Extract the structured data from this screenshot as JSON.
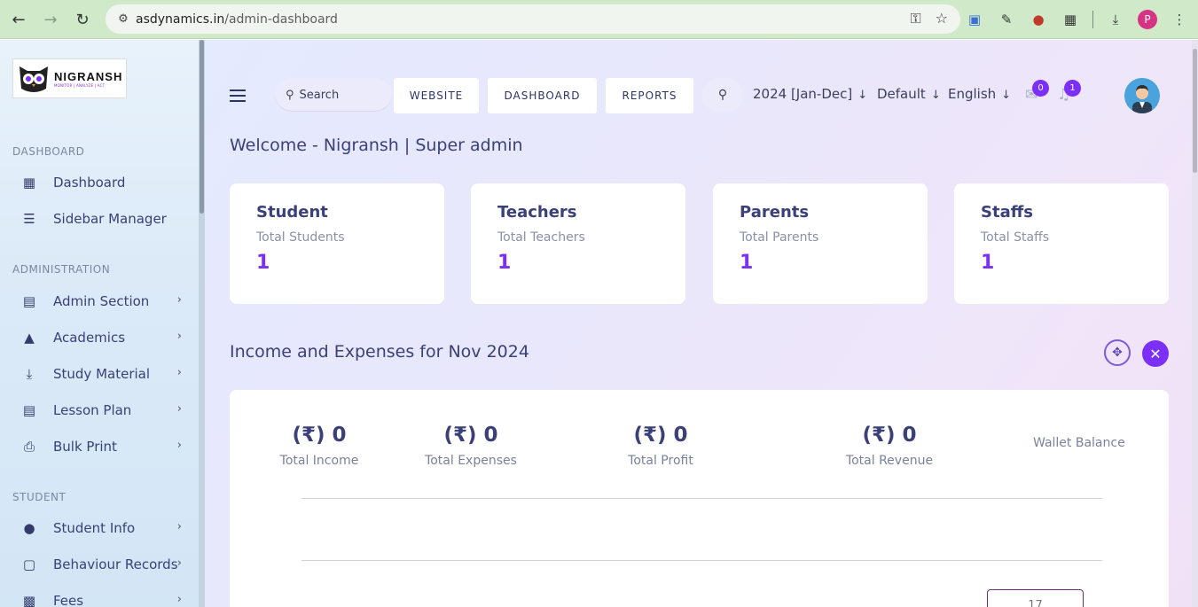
{
  "browser": {
    "url_host": "asdynamics.in",
    "url_path": "/admin-dashboard",
    "profile_initial": "P"
  },
  "logo": {
    "name": "NIGRANSH",
    "tagline": "MONITOR | ANALYZE | ACT"
  },
  "sidebar": {
    "sections": [
      {
        "label": "DASHBOARD"
      },
      {
        "label": "ADMINISTRATION"
      },
      {
        "label": "STUDENT"
      }
    ],
    "items": [
      {
        "label": "Dashboard",
        "icon": "grid-icon"
      },
      {
        "label": "Sidebar Manager",
        "icon": "bars-icon"
      },
      {
        "label": "Admin Section",
        "icon": "admin-icon"
      },
      {
        "label": "Academics",
        "icon": "graduation-cap-icon"
      },
      {
        "label": "Study Material",
        "icon": "download-icon"
      },
      {
        "label": "Lesson Plan",
        "icon": "lesson-icon"
      },
      {
        "label": "Bulk Print",
        "icon": "printer-icon"
      },
      {
        "label": "Student Info",
        "icon": "user-icon"
      },
      {
        "label": "Behaviour Records",
        "icon": "records-icon"
      },
      {
        "label": "Fees",
        "icon": "money-icon"
      }
    ]
  },
  "header": {
    "search_placeholder": "Search",
    "buttons": [
      "WEBSITE",
      "DASHBOARD",
      "REPORTS"
    ],
    "session": "2024 [Jan-Dec]",
    "style": "Default",
    "language": "English",
    "messages_count": "0",
    "notifications_count": "1"
  },
  "welcome": "Welcome - Nigransh | Super admin",
  "cards": [
    {
      "title": "Student",
      "subtitle": "Total Students",
      "value": "1"
    },
    {
      "title": "Teachers",
      "subtitle": "Total Teachers",
      "value": "1"
    },
    {
      "title": "Parents",
      "subtitle": "Total Parents",
      "value": "1"
    },
    {
      "title": "Staffs",
      "subtitle": "Total Staffs",
      "value": "1"
    }
  ],
  "income_expenses": {
    "title": "Income and Expenses for Nov 2024",
    "stats": [
      {
        "amount": "(₹) 0",
        "label": "Total Income"
      },
      {
        "amount": "(₹) 0",
        "label": "Total Expenses"
      },
      {
        "amount": "(₹) 0",
        "label": "Total Profit"
      },
      {
        "amount": "(₹) 0",
        "label": "Total Revenue"
      }
    ],
    "wallet_label": "Wallet Balance",
    "mini_value": "17"
  },
  "colors": {
    "accent": "#7b2ff7",
    "text": "#3b4178",
    "chrome": "#cfe9c9"
  }
}
